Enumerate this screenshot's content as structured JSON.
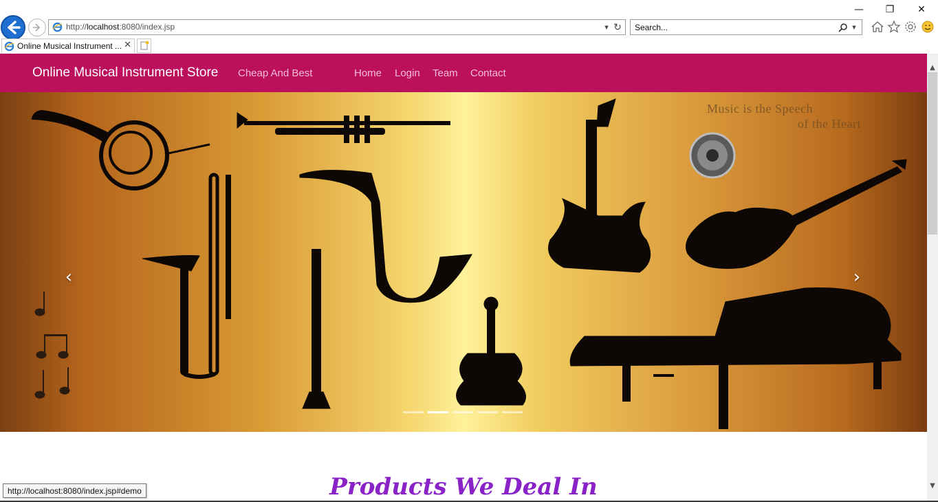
{
  "browser": {
    "address": {
      "scheme": "http://",
      "host": "localhost",
      "rest": ":8080/index.jsp"
    },
    "search_placeholder": "Search...",
    "tab_title": "Online Musical Instrument ...",
    "status_url": "http://localhost:8080/index.jsp#demo"
  },
  "navbar": {
    "brand": "Online Musical Instrument Store",
    "tagline": "Cheap And Best",
    "links": [
      "Home",
      "Login",
      "Team",
      "Contact"
    ]
  },
  "carousel": {
    "prev_glyph": "‹",
    "next_glyph": "›",
    "slide_count": 5,
    "active_index": 1,
    "banner_text": [
      "Music is the Speech",
      "of the Heart"
    ]
  },
  "main": {
    "section_title": "Products We Deal In"
  },
  "colors": {
    "navbar": "#bc0f5c",
    "title": "#8a23c7"
  }
}
